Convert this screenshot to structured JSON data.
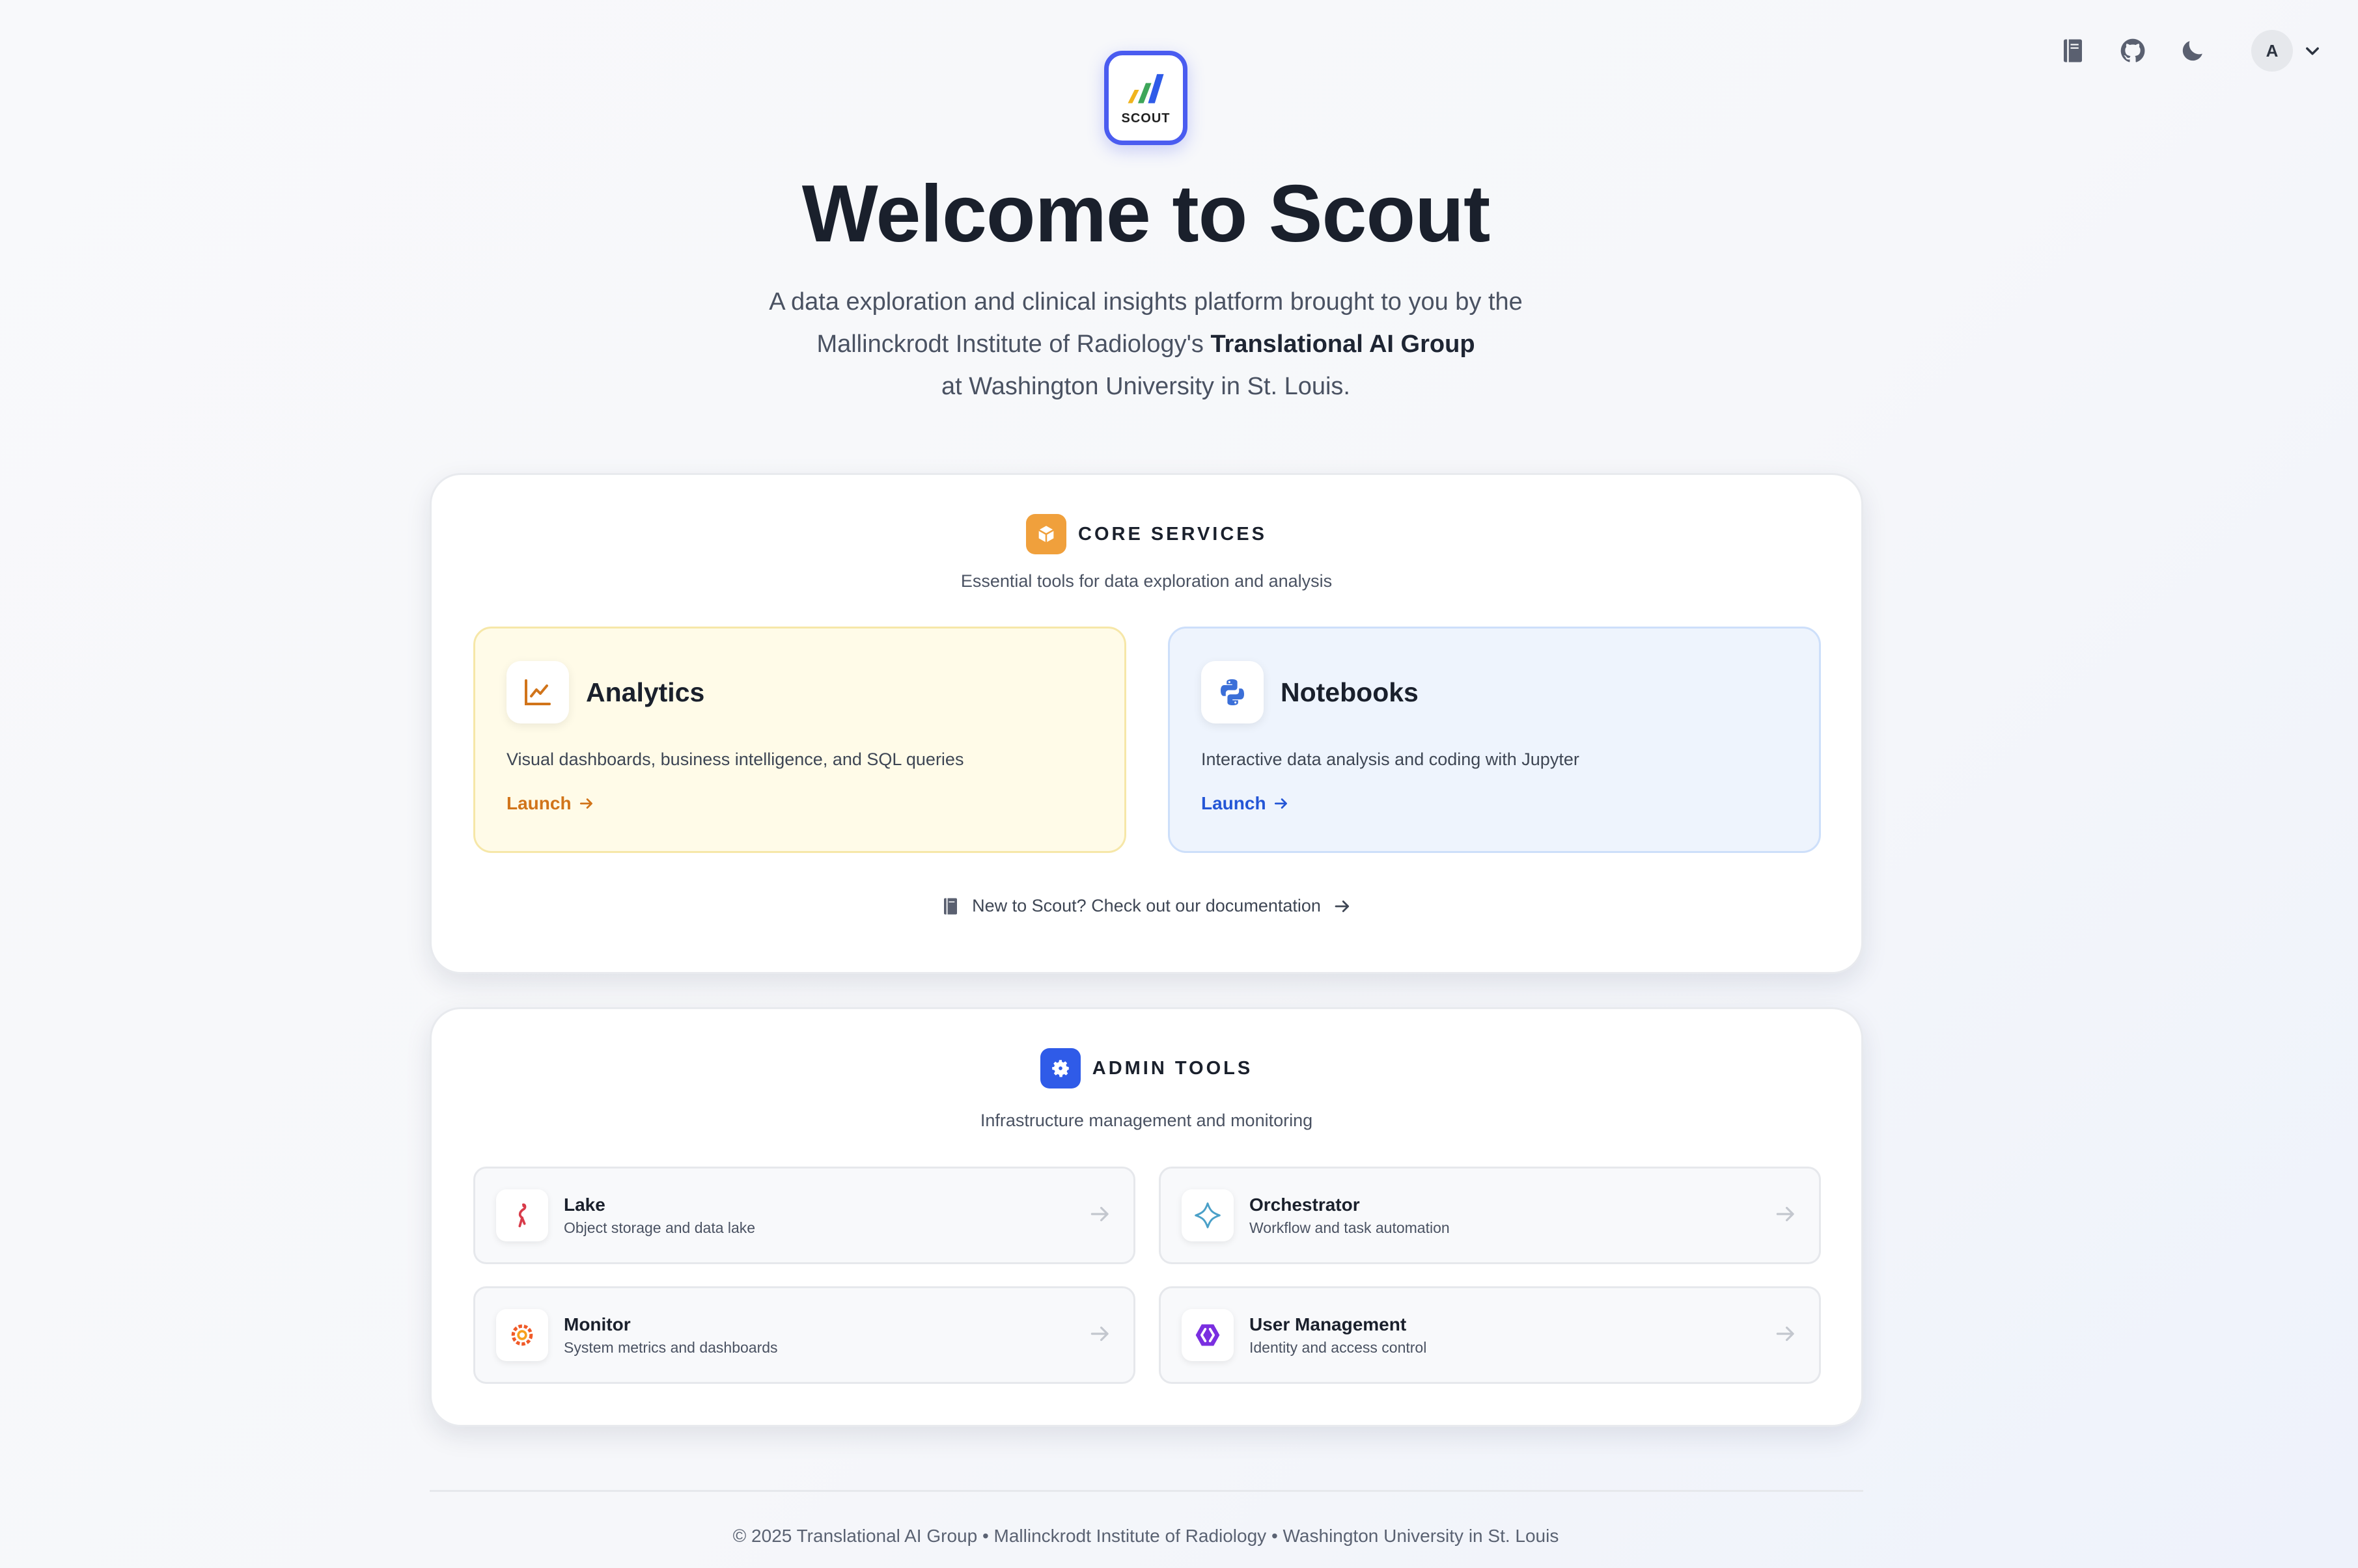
{
  "toolbar": {
    "docs_icon": "book-icon",
    "github_icon": "github-icon",
    "theme_icon": "moon-icon",
    "user_initial": "A"
  },
  "logo": {
    "text": "SCOUT"
  },
  "hero": {
    "title": "Welcome to Scout",
    "line1": "A data exploration and clinical insights platform brought to you by the",
    "line2_prefix": "Mallinckrodt Institute of Radiology's ",
    "line2_bold": "Translational AI Group",
    "line3": "at Washington University in St. Louis."
  },
  "core": {
    "title": "CORE SERVICES",
    "description": "Essential tools for data exploration and analysis",
    "badge_color": "#f0a03c",
    "cards": [
      {
        "title": "Analytics",
        "description": "Visual dashboards, business intelligence, and SQL queries",
        "launch": "Launch",
        "accent": "#d1741a"
      },
      {
        "title": "Notebooks",
        "description": "Interactive data analysis and coding with Jupyter",
        "launch": "Launch",
        "accent": "#2456d6"
      }
    ],
    "doc_link": "New to Scout? Check out our documentation"
  },
  "admin": {
    "title": "ADMIN TOOLS",
    "description": "Infrastructure management and monitoring",
    "badge_color": "#2f5be8",
    "tiles": [
      {
        "title": "Lake",
        "subtitle": "Object storage and data lake",
        "icon": "flamingo-icon"
      },
      {
        "title": "Orchestrator",
        "subtitle": "Workflow and task automation",
        "icon": "orchestrator-icon"
      },
      {
        "title": "Monitor",
        "subtitle": "System metrics and dashboards",
        "icon": "grafana-icon"
      },
      {
        "title": "User Management",
        "subtitle": "Identity and access control",
        "icon": "keycloak-icon"
      }
    ]
  },
  "footer": {
    "text": "© 2025 Translational AI Group • Mallinckrodt Institute of Radiology • Washington University in St. Louis"
  }
}
